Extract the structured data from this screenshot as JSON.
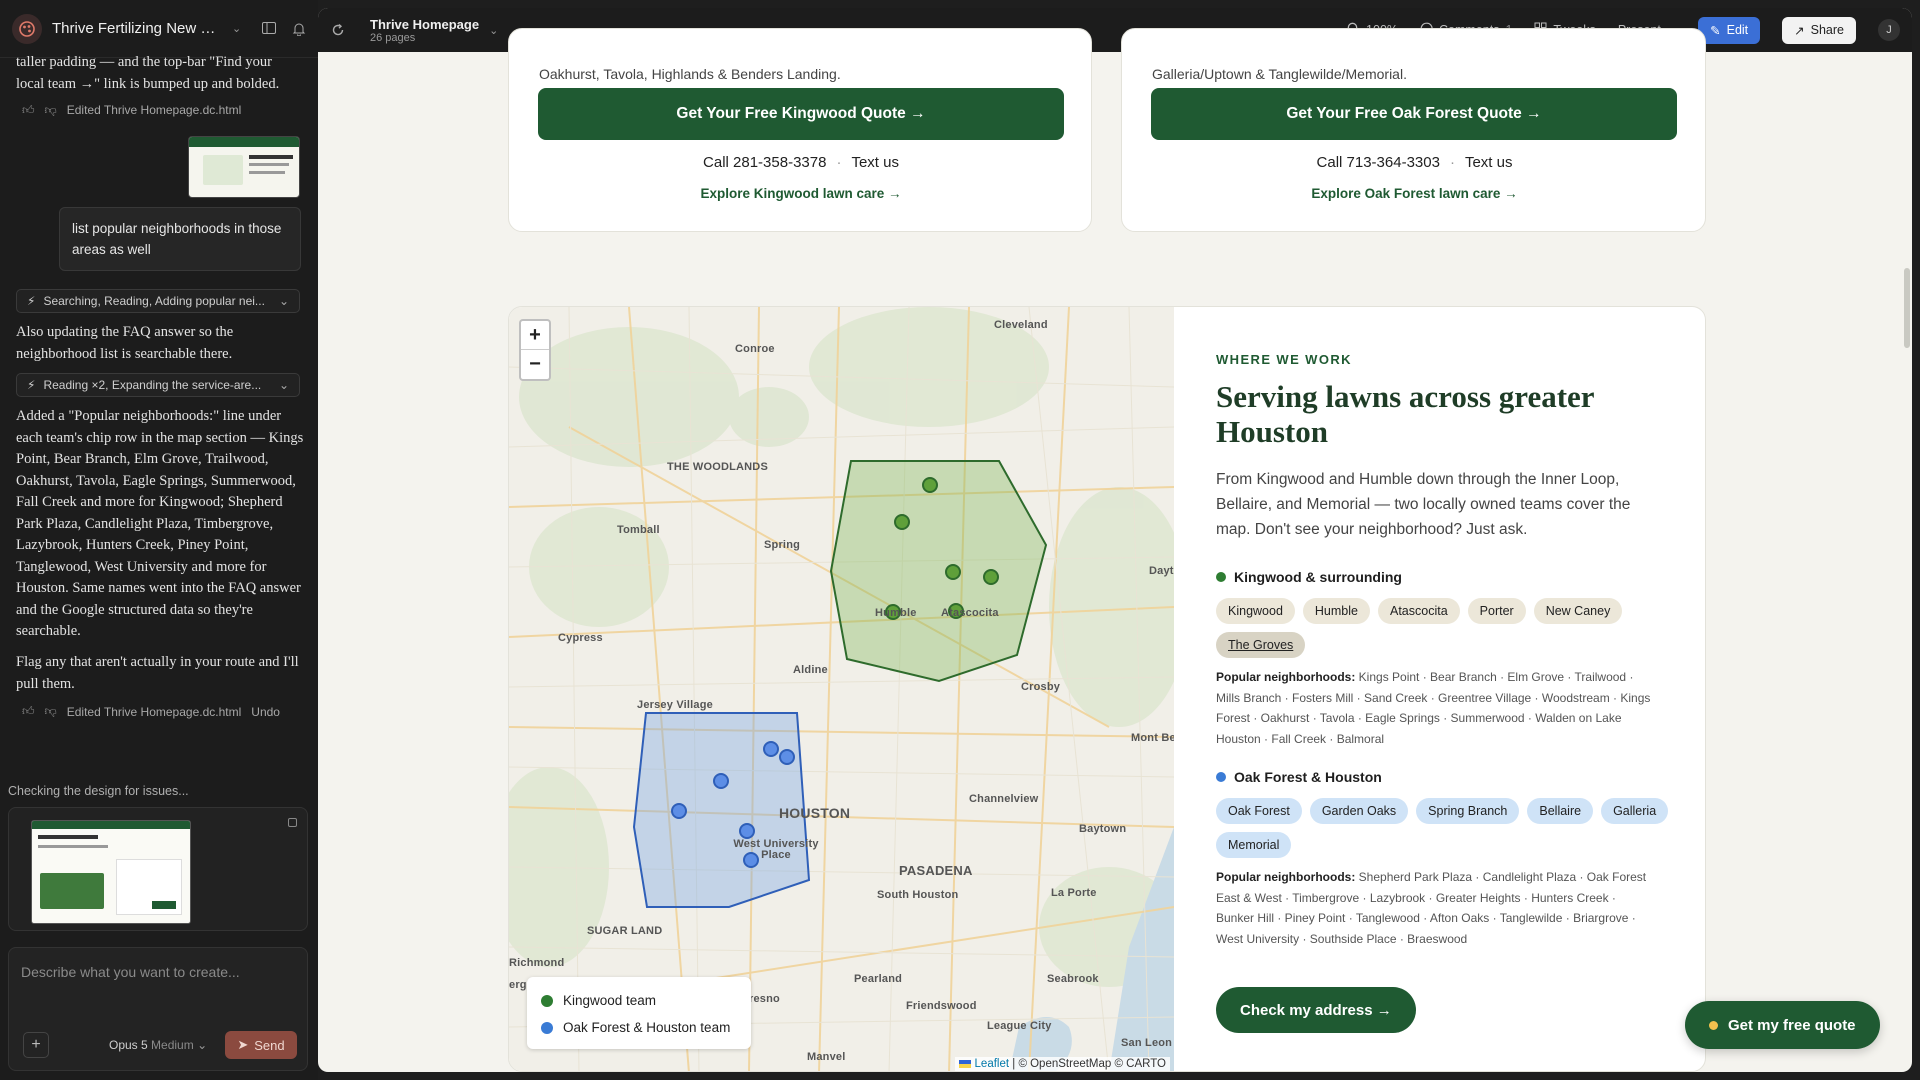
{
  "sidebar": {
    "project_title": "Thrive Fertilizing New W...",
    "messages": {
      "top_fragment": "taller padding — and the top-bar \"Find your local team →\" link is bumped up and bolded.",
      "edited_1": "Edited Thrive Homepage.dc.html",
      "user_msg": "list popular neighborhoods in those areas as well",
      "tool_1": "Searching, Reading, Adding popular nei...",
      "assist_1": "Also updating the FAQ answer so the neighborhood list is searchable there.",
      "tool_2": "Reading ×2, Expanding the service-are...",
      "assist_2": "Added a \"Popular neighborhoods:\" line under each team's chip row in the map section — Kings Point, Bear Branch, Elm Grove, Trailwood, Oakhurst, Tavola, Eagle Springs, Summerwood, Fall Creek and more for Kingwood; Shepherd Park Plaza, Candlelight Plaza, Timbergrove, Lazybrook, Hunters Creek, Piney Point, Tanglewood, West University and more for Houston. Same names went into the FAQ answer and the Google structured data so they're searchable.",
      "assist_3": "Flag any that aren't actually in your route and I'll pull them.",
      "edited_2": "Edited Thrive Homepage.dc.html",
      "undo": "Undo"
    },
    "checking": "Checking the design for issues...",
    "composer": {
      "placeholder": "Describe what you want to create...",
      "model": "Opus 5",
      "level": "Medium",
      "send": "Send"
    }
  },
  "topbar": {
    "doc_name": "Thrive Homepage",
    "pages": "26 pages",
    "zoom": "100%",
    "comments": "Comments",
    "comments_count": "1",
    "tweaks": "Tweaks",
    "present": "Present",
    "edit": "Edit",
    "share": "Share",
    "avatar": "J"
  },
  "cards": {
    "left": {
      "partial_text": "Oakhurst, Tavola, Highlands & Benders Landing.",
      "button": "Get Your Free Kingwood Quote →",
      "call": "Call 281-358-3378",
      "text": "Text us",
      "explore": "Explore Kingwood lawn care →"
    },
    "right": {
      "partial_text": "Galleria/Uptown & Tanglewilde/Memorial.",
      "button": "Get Your Free Oak Forest Quote →",
      "call": "Call 713-364-3303",
      "text": "Text us",
      "explore": "Explore Oak Forest lawn care →"
    }
  },
  "map": {
    "zoom_in": "+",
    "zoom_out": "−",
    "labels": {
      "cleveland": "Cleveland",
      "conroe": "Conroe",
      "woodlands": "THE WOODLANDS",
      "tomball": "Tomball",
      "spring": "Spring",
      "humble": "Humble",
      "atascocita": "Atascocita",
      "dayton": "Dayto",
      "cypress": "Cypress",
      "aldine": "Aldine",
      "crosby": "Crosby",
      "jersey": "Jersey Village",
      "montbel": "Mont Be",
      "houston": "HOUSTON",
      "channelview": "Channelview",
      "baytown": "Baytown",
      "westu": "West University Place",
      "pasadena": "PASADENA",
      "southhouston": "South Houston",
      "laporte": "La Porte",
      "sugarland": "SUGAR LAND",
      "richmond": "Richmond",
      "erg": "erg",
      "fresno": "resno",
      "pearland": "Pearland",
      "seabrook": "Seabrook",
      "friendswood": "Friendswood",
      "leaguecity": "League City",
      "manvel": "Manvel",
      "sanleon": "San Leon"
    },
    "legend": {
      "kingwood": "Kingwood team",
      "houston": "Oak Forest & Houston team"
    },
    "attribution": {
      "leaflet": "Leaflet",
      "rest": "| © OpenStreetMap © CARTO"
    }
  },
  "section": {
    "eyebrow": "WHERE WE WORK",
    "title": "Serving lawns across greater Houston",
    "lead": "From Kingwood and Humble down through the Inner Loop, Bellaire, and Memorial — two locally owned teams cover the map. Don't see your neighborhood? Just ask.",
    "kingwood": {
      "heading": "Kingwood & surrounding",
      "chips": [
        "Kingwood",
        "Humble",
        "Atascocita",
        "Porter",
        "New Caney",
        "The Groves"
      ],
      "pop_label": "Popular neighborhoods:",
      "pop_text": "Kings Point · Bear Branch · Elm Grove · Trailwood · Mills Branch · Fosters Mill · Sand Creek · Greentree Village · Woodstream · Kings Forest · Oakhurst · Tavola · Eagle Springs · Summerwood · Walden on Lake Houston · Fall Creek · Balmoral"
    },
    "houston": {
      "heading": "Oak Forest & Houston",
      "chips": [
        "Oak Forest",
        "Garden Oaks",
        "Spring Branch",
        "Bellaire",
        "Galleria",
        "Memorial"
      ],
      "pop_label": "Popular neighborhoods:",
      "pop_text": "Shepherd Park Plaza · Candlelight Plaza · Oak Forest East & West · Timbergrove · Lazybrook · Greater Heights · Hunters Creek · Bunker Hill · Piney Point · Tanglewood · Afton Oaks · Tanglewilde · Briargrove · West University · Southside Place · Braeswood"
    },
    "check_button": "Check my address →",
    "float_button": "Get my free quote"
  },
  "colors": {
    "brand_green": "#1f5a32",
    "kingwood_dot": "#2e7d32",
    "houston_dot": "#3a7bd5"
  }
}
